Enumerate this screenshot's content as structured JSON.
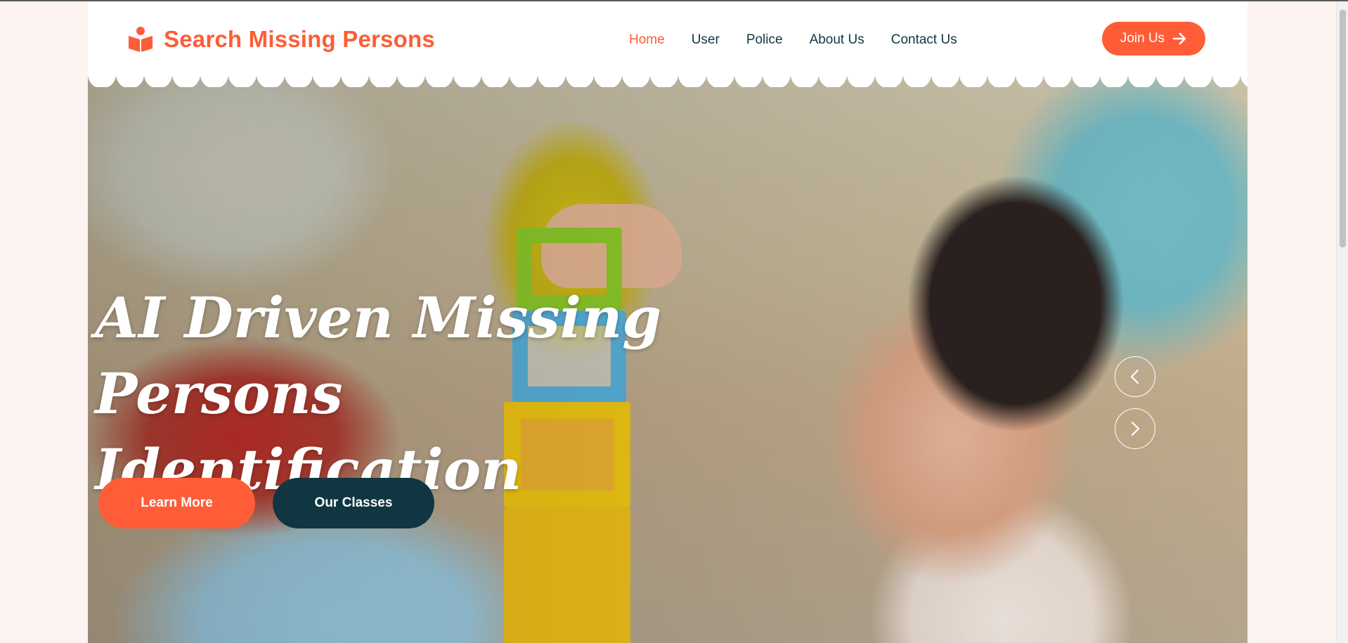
{
  "header": {
    "brand_name": "Search Missing Persons",
    "brand_icon": "book-reader-icon",
    "nav": [
      {
        "label": "Home",
        "active": true
      },
      {
        "label": "User",
        "active": false
      },
      {
        "label": "Police",
        "active": false
      },
      {
        "label": "About Us",
        "active": false
      },
      {
        "label": "Contact Us",
        "active": false
      }
    ],
    "join_label": "Join Us",
    "join_icon": "arrow-right-icon"
  },
  "hero": {
    "title_line1": "AI Driven Missing Persons",
    "title_line2": "Identification",
    "learn_more_label": "Learn More",
    "our_classes_label": "Our Classes",
    "prev_icon": "chevron-left-icon",
    "next_icon": "chevron-right-icon"
  },
  "colors": {
    "primary": "#fe5d37",
    "dark": "#103741",
    "background": "#fdf3f1",
    "header_bg": "#ffffff"
  }
}
